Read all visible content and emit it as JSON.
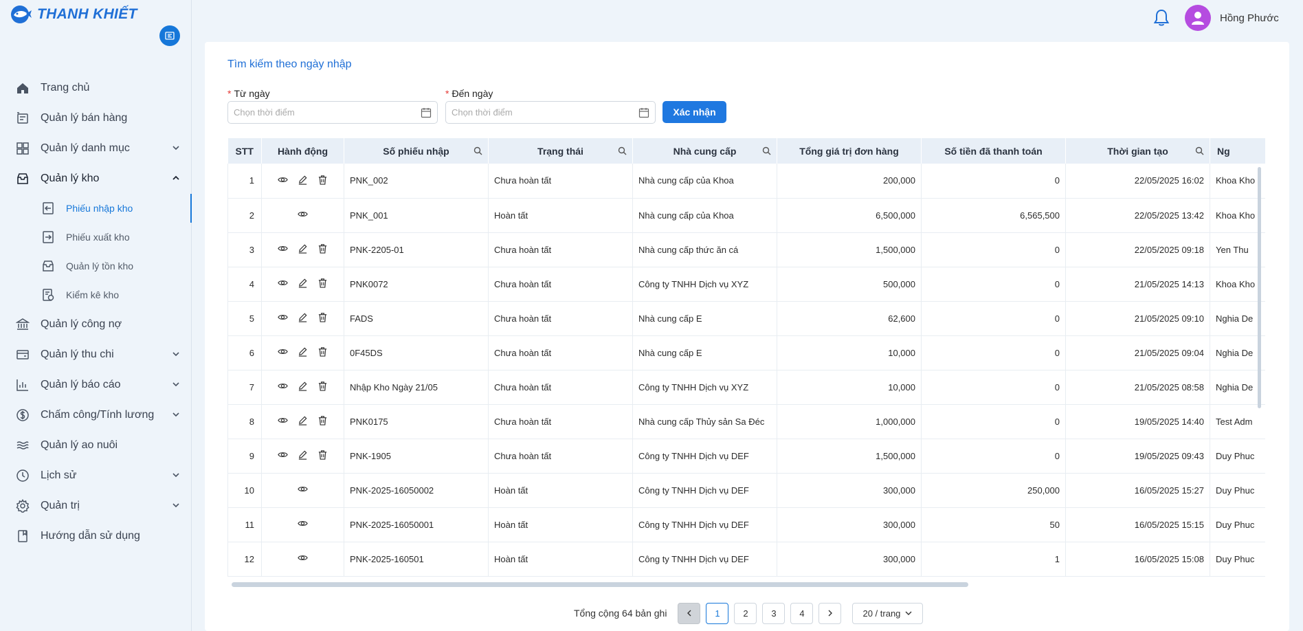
{
  "brand": {
    "name": "THANH KHIẾT"
  },
  "sidebar": {
    "items": [
      {
        "label": "Trang chủ",
        "icon": "home-icon"
      },
      {
        "label": "Quản lý bán hàng",
        "icon": "sales-icon"
      },
      {
        "label": "Quản lý danh mục",
        "icon": "grid-icon"
      },
      {
        "label": "Quản lý kho",
        "icon": "warehouse-icon"
      },
      {
        "label": "Quản lý công nợ",
        "icon": "bank-icon"
      },
      {
        "label": "Quản lý thu chi",
        "icon": "wallet-icon"
      },
      {
        "label": "Quản lý báo cáo",
        "icon": "chart-icon"
      },
      {
        "label": "Chấm công/Tính lương",
        "icon": "dollar-icon"
      },
      {
        "label": "Quản lý ao nuôi",
        "icon": "water-icon"
      },
      {
        "label": "Lịch sử",
        "icon": "clock-icon"
      },
      {
        "label": "Quản trị",
        "icon": "settings-icon"
      },
      {
        "label": "Hướng dẫn sử dụng",
        "icon": "book-icon"
      }
    ],
    "submenu": [
      {
        "label": "Phiếu nhập kho",
        "icon": "import-icon",
        "active": true
      },
      {
        "label": "Phiếu xuất kho",
        "icon": "export-icon"
      },
      {
        "label": "Quản lý tồn kho",
        "icon": "inbox-icon"
      },
      {
        "label": "Kiểm kê kho",
        "icon": "audit-icon"
      }
    ]
  },
  "header": {
    "username": "Hồng Phước"
  },
  "search": {
    "title": "Tìm kiếm theo ngày nhập",
    "from_label": "Từ ngày",
    "to_label": "Đến ngày",
    "placeholder": "Chọn thời điểm",
    "confirm_label": "Xác nhận"
  },
  "table": {
    "columns": [
      "STT",
      "Hành động",
      "Số phiếu nhập",
      "Trạng thái",
      "Nhà cung cấp",
      "Tổng giá trị đơn hàng",
      "Số tiền đã thanh toán",
      "Thời gian tạo",
      "Ng"
    ],
    "rows": [
      {
        "stt": "1",
        "actions": "view,edit,delete",
        "code": "PNK_002",
        "status": "Chưa hoàn tất",
        "supplier": "Nhà cung cấp của Khoa",
        "total": "200,000",
        "paid": "0",
        "created": "22/05/2025 16:02",
        "creator": "Khoa Kho"
      },
      {
        "stt": "2",
        "actions": "view",
        "code": "PNK_001",
        "status": "Hoàn tất",
        "supplier": "Nhà cung cấp của Khoa",
        "total": "6,500,000",
        "paid": "6,565,500",
        "created": "22/05/2025 13:42",
        "creator": "Khoa Kho"
      },
      {
        "stt": "3",
        "actions": "view,edit,delete",
        "code": "PNK-2205-01",
        "status": "Chưa hoàn tất",
        "supplier": "Nhà cung cấp thức ăn cá",
        "total": "1,500,000",
        "paid": "0",
        "created": "22/05/2025 09:18",
        "creator": "Yen Thu"
      },
      {
        "stt": "4",
        "actions": "view,edit,delete",
        "code": "PNK0072",
        "status": "Chưa hoàn tất",
        "supplier": "Công ty TNHH Dịch vụ XYZ",
        "total": "500,000",
        "paid": "0",
        "created": "21/05/2025 14:13",
        "creator": "Khoa Kho"
      },
      {
        "stt": "5",
        "actions": "view,edit,delete",
        "code": "FADS",
        "status": "Chưa hoàn tất",
        "supplier": "Nhà cung cấp E",
        "total": "62,600",
        "paid": "0",
        "created": "21/05/2025 09:10",
        "creator": "Nghia De"
      },
      {
        "stt": "6",
        "actions": "view,edit,delete",
        "code": "0F45DS",
        "status": "Chưa hoàn tất",
        "supplier": "Nhà cung cấp E",
        "total": "10,000",
        "paid": "0",
        "created": "21/05/2025 09:04",
        "creator": "Nghia De"
      },
      {
        "stt": "7",
        "actions": "view,edit,delete",
        "code": "Nhập Kho Ngày 21/05",
        "status": "Chưa hoàn tất",
        "supplier": "Công ty TNHH Dịch vụ XYZ",
        "total": "10,000",
        "paid": "0",
        "created": "21/05/2025 08:58",
        "creator": "Nghia De"
      },
      {
        "stt": "8",
        "actions": "view,edit,delete",
        "code": "PNK0175",
        "status": "Chưa hoàn tất",
        "supplier": "Nhà cung cấp Thủy sản Sa Đéc",
        "total": "1,000,000",
        "paid": "0",
        "created": "19/05/2025 14:40",
        "creator": "Test Adm"
      },
      {
        "stt": "9",
        "actions": "view,edit,delete",
        "code": "PNK-1905",
        "status": "Chưa hoàn tất",
        "supplier": "Công ty TNHH Dịch vụ DEF",
        "total": "1,500,000",
        "paid": "0",
        "created": "19/05/2025 09:43",
        "creator": "Duy Phuc"
      },
      {
        "stt": "10",
        "actions": "view",
        "code": "PNK-2025-16050002",
        "status": "Hoàn tất",
        "supplier": "Công ty TNHH Dịch vụ DEF",
        "total": "300,000",
        "paid": "250,000",
        "created": "16/05/2025 15:27",
        "creator": "Duy Phuc"
      },
      {
        "stt": "11",
        "actions": "view",
        "code": "PNK-2025-16050001",
        "status": "Hoàn tất",
        "supplier": "Công ty TNHH Dịch vụ DEF",
        "total": "300,000",
        "paid": "50",
        "created": "16/05/2025 15:15",
        "creator": "Duy Phuc"
      },
      {
        "stt": "12",
        "actions": "view",
        "code": "PNK-2025-160501",
        "status": "Hoàn tất",
        "supplier": "Công ty TNHH Dịch vụ DEF",
        "total": "300,000",
        "paid": "1",
        "created": "16/05/2025 15:08",
        "creator": "Duy Phuc"
      }
    ]
  },
  "pagination": {
    "total_text": "Tổng cộng 64 bản ghi",
    "pages": [
      "1",
      "2",
      "3",
      "4"
    ],
    "current": "1",
    "per_page": "20 / trang"
  },
  "colors": {
    "accent": "#1677d9",
    "brand": "#1f6fd6",
    "avatar": "#b54ce0"
  }
}
